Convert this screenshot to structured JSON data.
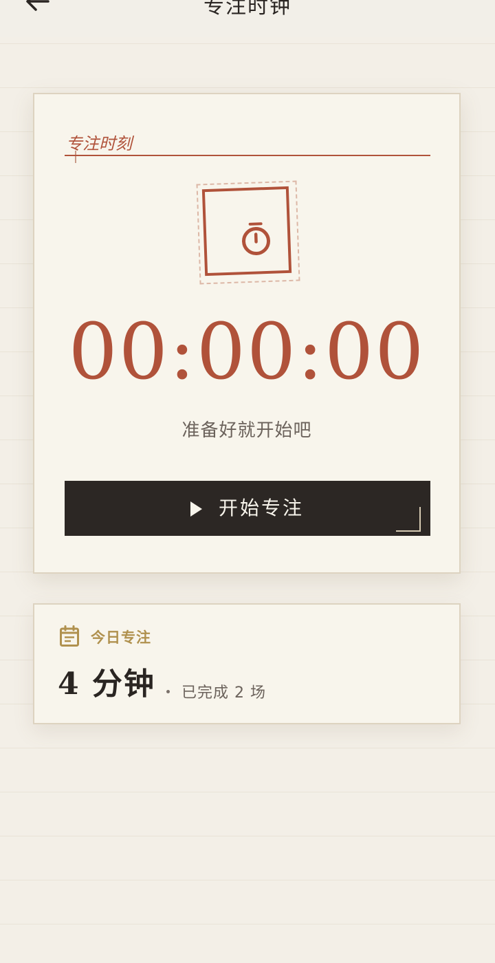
{
  "header": {
    "title": "专注时钟",
    "back_icon": "arrow-left-icon"
  },
  "timer_card": {
    "section_label": "专注时刻",
    "stamp_icon": "stopwatch-icon",
    "display": "00:00:00",
    "hint": "准备好就开始吧",
    "start_button": {
      "icon": "play-icon",
      "label": "开始专注"
    }
  },
  "today": {
    "icon": "calendar-icon",
    "label": "今日专注",
    "minutes": "4 分钟",
    "sessions": "已完成 2 场"
  },
  "colors": {
    "background": "#f3efe7",
    "card": "#f8f5ec",
    "accent": "#b0523a",
    "button": "#2c2724",
    "gold": "#b0914e",
    "text_dark": "#2a2522",
    "text_muted": "#6b625b"
  }
}
